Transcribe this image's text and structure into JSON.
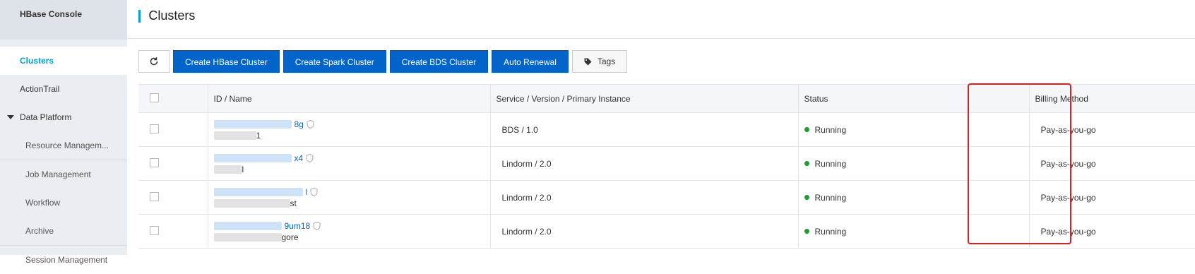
{
  "sidebar": {
    "title": "HBase Console",
    "items": [
      {
        "label": "Clusters"
      },
      {
        "label": "ActionTrail"
      },
      {
        "label": "Data Platform"
      },
      {
        "label": "Resource Managem..."
      },
      {
        "label": "Job Management"
      },
      {
        "label": "Workflow"
      },
      {
        "label": "Archive"
      },
      {
        "label": "Session Management"
      }
    ]
  },
  "header": {
    "title": "Clusters"
  },
  "toolbar": {
    "refresh_icon": "refresh-icon",
    "create_hbase": "Create HBase Cluster",
    "create_spark": "Create Spark Cluster",
    "create_bds": "Create BDS Cluster",
    "auto_renewal": "Auto Renewal",
    "tags": "Tags",
    "tags_icon": "tag-icon"
  },
  "table": {
    "headers": {
      "id_name": "ID / Name",
      "service": "Service / Version / Primary Instance",
      "status": "Status",
      "billing": "Billing Method"
    },
    "rows": [
      {
        "id_suffix": "8g",
        "name_suffix": "1",
        "service": "BDS / 1.0",
        "status": "Running",
        "billing": "Pay-as-you-go"
      },
      {
        "id_suffix": "x4",
        "name_suffix": "l",
        "service": "Lindorm / 2.0",
        "status": "Running",
        "billing": "Pay-as-you-go"
      },
      {
        "id_suffix": "l",
        "name_suffix": "st",
        "service": "Lindorm / 2.0",
        "status": "Running",
        "billing": "Pay-as-you-go"
      },
      {
        "id_suffix": "9um18",
        "name_suffix": "gore",
        "service": "Lindorm / 2.0",
        "status": "Running",
        "billing": "Pay-as-you-go"
      }
    ]
  },
  "colors": {
    "accent": "#00a2ca",
    "primary_button": "#0064c8",
    "running": "#1e9e2f",
    "highlight": "#e02020"
  }
}
